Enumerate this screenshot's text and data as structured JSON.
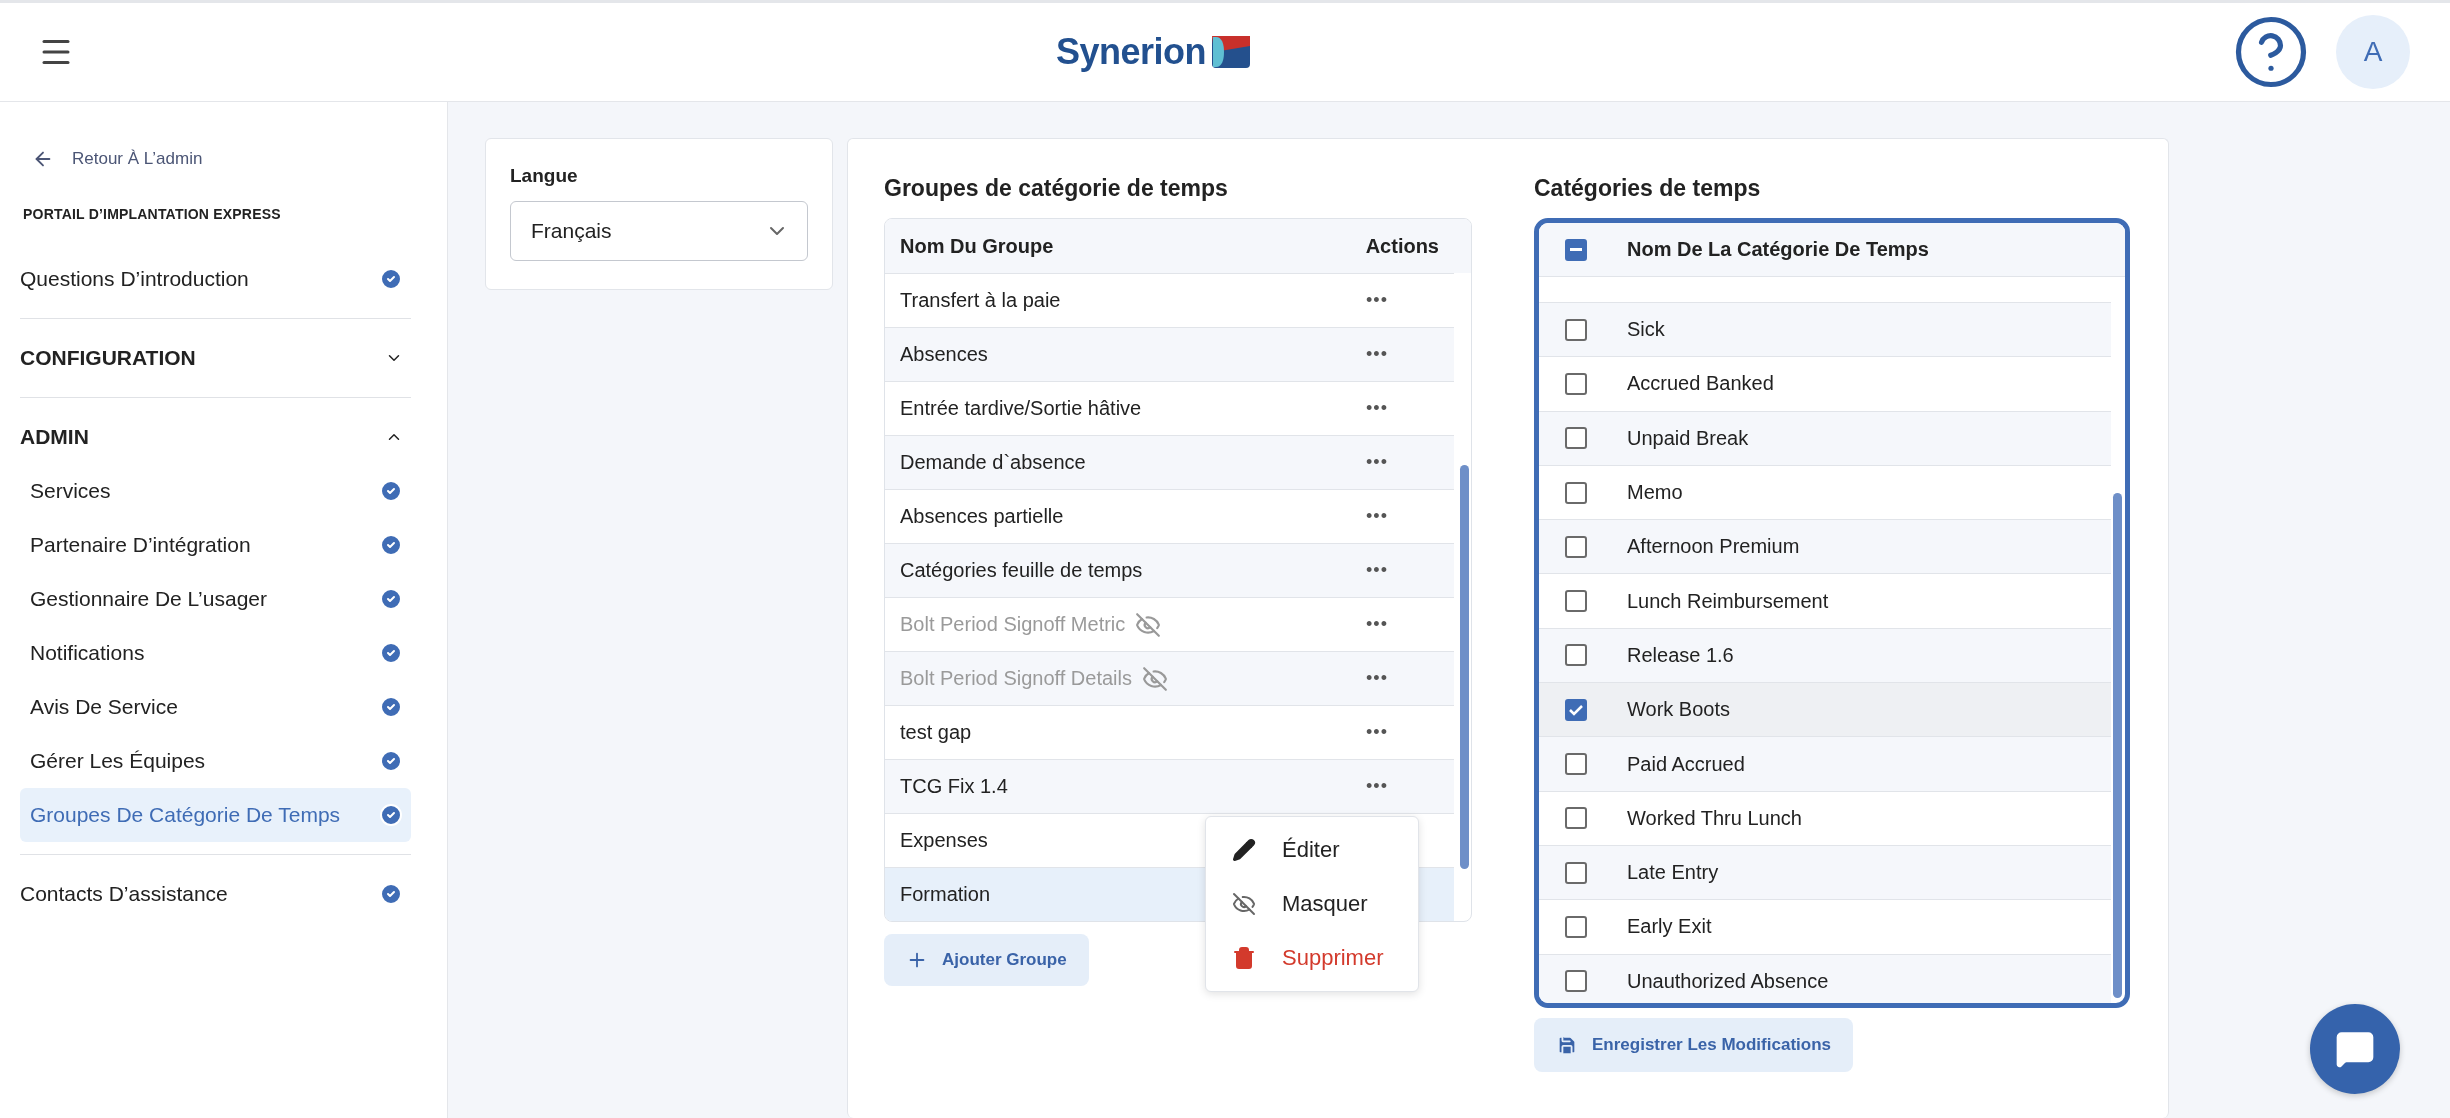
{
  "header": {
    "logo": "Synerion",
    "avatar": "A"
  },
  "sidebar": {
    "back": "Retour À L’admin",
    "portal_title": "PORTAIL D’IMPLANTATION EXPRESS",
    "items": [
      {
        "kind": "link",
        "label": "Questions D’introduction",
        "done": true,
        "selected": false
      },
      {
        "kind": "section",
        "label": "CONFIGURATION",
        "expanded": false
      },
      {
        "kind": "section",
        "label": "ADMIN",
        "expanded": true,
        "children": [
          {
            "label": "Services",
            "done": true,
            "selected": false
          },
          {
            "label": "Partenaire D’intégration",
            "done": true,
            "selected": false
          },
          {
            "label": "Gestionnaire De L’usager",
            "done": true,
            "selected": false
          },
          {
            "label": "Notifications",
            "done": true,
            "selected": false
          },
          {
            "label": "Avis De Service",
            "done": true,
            "selected": false
          },
          {
            "label": "Gérer Les Équipes",
            "done": true,
            "selected": false
          },
          {
            "label": "Groupes De Catégorie De Temps",
            "done": true,
            "selected": true
          }
        ]
      },
      {
        "kind": "link",
        "label": "Contacts D’assistance",
        "done": true,
        "selected": false
      }
    ]
  },
  "language": {
    "label": "Langue",
    "value": "Français"
  },
  "groups": {
    "title": "Groupes de catégorie de temps",
    "columns": [
      "Nom Du Groupe",
      "Actions"
    ],
    "rows": [
      {
        "name": "Transfert à la paie",
        "hidden": false,
        "selected": false,
        "actions": "•••"
      },
      {
        "name": "Absences",
        "hidden": false,
        "selected": false,
        "actions": "•••"
      },
      {
        "name": "Entrée tardive/Sortie hâtive",
        "hidden": false,
        "selected": false,
        "actions": "•••"
      },
      {
        "name": "Demande d`absence",
        "hidden": false,
        "selected": false,
        "actions": "•••"
      },
      {
        "name": "Absences partielle",
        "hidden": false,
        "selected": false,
        "actions": "•••"
      },
      {
        "name": "Catégories feuille de temps",
        "hidden": false,
        "selected": false,
        "actions": "•••"
      },
      {
        "name": "Bolt Period Signoff Metric",
        "hidden": true,
        "selected": false,
        "actions": "•••"
      },
      {
        "name": "Bolt Period Signoff Details",
        "hidden": true,
        "selected": false,
        "actions": "•••"
      },
      {
        "name": "test gap",
        "hidden": false,
        "selected": false,
        "actions": "•••"
      },
      {
        "name": "TCG Fix 1.4",
        "hidden": false,
        "selected": false,
        "actions": "•••"
      },
      {
        "name": "Expenses",
        "hidden": false,
        "selected": false
      },
      {
        "name": "Formation",
        "hidden": false,
        "selected": true
      }
    ],
    "add_button": "Ajouter Groupe",
    "menu": [
      {
        "kind": "edit",
        "label": "Éditer"
      },
      {
        "kind": "hide",
        "label": "Masquer"
      },
      {
        "kind": "delete",
        "label": "Supprimer"
      }
    ]
  },
  "categories": {
    "title": "Catégories de temps",
    "header": {
      "label": "Nom De La Catégorie De Temps",
      "indeterminate": true
    },
    "rows": [
      {
        "name": "Sick",
        "checked": false
      },
      {
        "name": "Accrued Banked",
        "checked": false
      },
      {
        "name": "Unpaid Break",
        "checked": false
      },
      {
        "name": "Memo",
        "checked": false
      },
      {
        "name": "Afternoon Premium",
        "checked": false
      },
      {
        "name": "Lunch Reimbursement",
        "checked": false
      },
      {
        "name": "Release 1.6",
        "checked": false
      },
      {
        "name": "Work Boots",
        "checked": true
      },
      {
        "name": "Paid Accrued",
        "checked": false
      },
      {
        "name": "Worked Thru Lunch",
        "checked": false
      },
      {
        "name": "Late Entry",
        "checked": false
      },
      {
        "name": "Early Exit",
        "checked": false
      },
      {
        "name": "Unauthorized Absence",
        "checked": false
      }
    ],
    "save_button": "Enregistrer Les Modifications"
  }
}
